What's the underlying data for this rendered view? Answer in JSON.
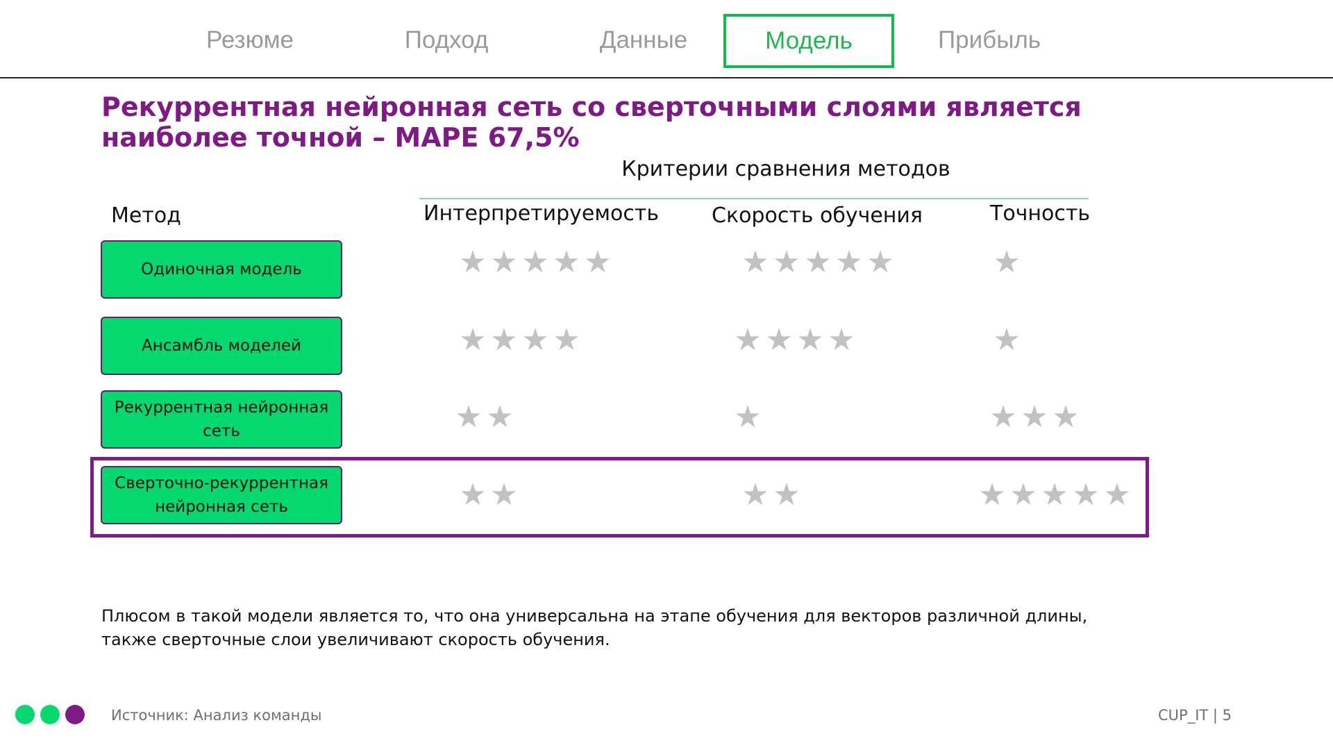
{
  "nav": {
    "tabs": [
      {
        "label": "Резюме",
        "active": false
      },
      {
        "label": "Подход",
        "active": false
      },
      {
        "label": "Данные",
        "active": false
      },
      {
        "label": "Модель",
        "active": true
      },
      {
        "label": "Прибыль",
        "active": false
      }
    ]
  },
  "title": "Рекуррентная нейронная сеть со сверточными слоями является наиболее точной – MAPE 67,5%",
  "table": {
    "criteria_title": "Критерии сравнения методов",
    "method_header": "Метод",
    "criteria": [
      "Интерпретируемость",
      "Скорость обучения",
      "Точность"
    ],
    "rows": [
      {
        "method": "Одиночная модель",
        "ratings": [
          5,
          5,
          1
        ]
      },
      {
        "method": "Ансамбль моделей",
        "ratings": [
          4,
          4,
          1
        ]
      },
      {
        "method": "Рекуррентная нейронная сеть",
        "ratings": [
          2,
          1,
          3
        ]
      },
      {
        "method": "Сверточно-рекуррентная нейронная сеть",
        "ratings": [
          2,
          2,
          5
        ],
        "highlighted": true
      }
    ]
  },
  "note": "Плюсом в такой модели является то, что она универсальна на этапе обучения для векторов различной длины,  также сверточные слои увеличивают скорость обучения.",
  "footer": {
    "source": "Источник: Анализ команды",
    "brand": "CUP_IT | 5"
  },
  "colors": {
    "accent_purple": "#7e1a84",
    "accent_green": "#05d86e",
    "star": "#c2c2c2"
  }
}
